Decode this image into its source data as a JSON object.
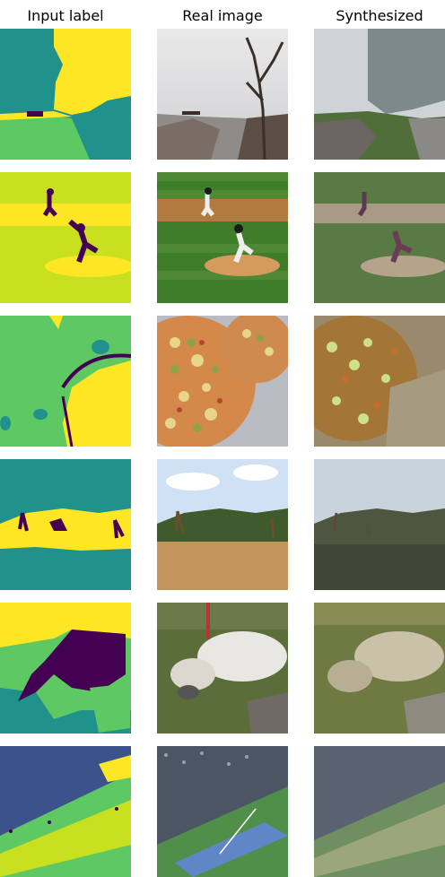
{
  "headers": [
    "Input label",
    "Real image",
    "Synthesized"
  ],
  "rows": [
    {
      "scene": "foggy coastal trail with bare tree and bench"
    },
    {
      "scene": "baseball pitcher on mound with fielder"
    },
    {
      "scene": "two pizzas with vegetable toppings"
    },
    {
      "scene": "giraffes in savanna grassland"
    },
    {
      "scene": "sheep grazing on grass with rocks"
    },
    {
      "scene": "tennis stadium court with crowd"
    }
  ],
  "palette": {
    "purple": "#440154",
    "indigo": "#3b528b",
    "teal": "#21918c",
    "green": "#5ec962",
    "lime": "#c8e020",
    "yellow": "#fde725"
  }
}
